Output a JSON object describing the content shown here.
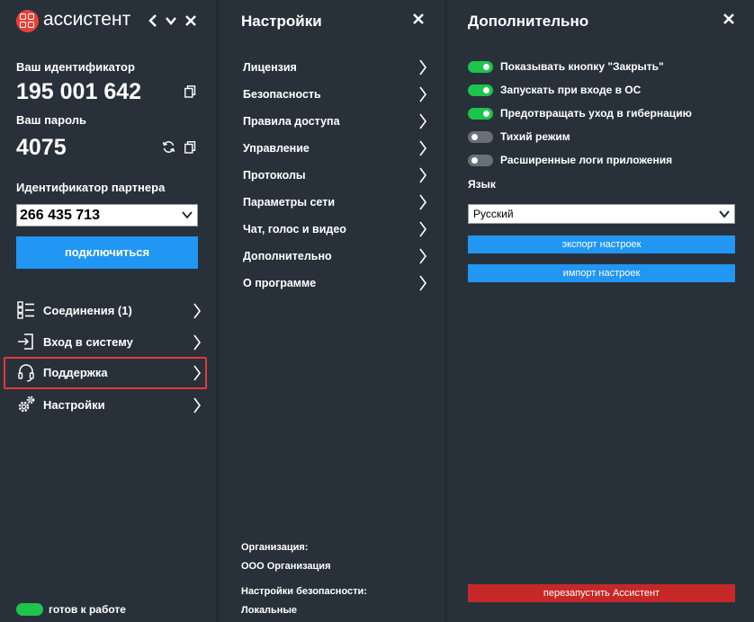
{
  "left_panel": {
    "app_title": "ассистент",
    "id_label": "Ваш идентификатор",
    "id_value": "195 001 642",
    "password_label": "Ваш пароль",
    "password_value": "4075",
    "partner_label": "Идентификатор партнера",
    "partner_value": "266 435 713",
    "connect_label": "подключиться",
    "nav": [
      {
        "label": "Соединения (1)",
        "icon": "list-icon"
      },
      {
        "label": "Вход в систему",
        "icon": "login-icon"
      },
      {
        "label": "Поддержка",
        "icon": "headset-icon"
      },
      {
        "label": "Настройки",
        "icon": "gears-icon"
      }
    ],
    "status_text": "готов к работе"
  },
  "settings_panel": {
    "title": "Настройки",
    "items": [
      "Лицензия",
      "Безопасность",
      "Правила доступа",
      "Управление",
      "Протоколы",
      "Параметры сети",
      "Чат, голос и видео",
      "Дополнительно",
      "О программе"
    ],
    "org_label": "Организация:",
    "org_value": "ООО Организация",
    "security_label": "Настройки безопасности:",
    "security_value": "Локальные"
  },
  "advanced_panel": {
    "title": "Дополнительно",
    "options": [
      {
        "label": "Показывать кнопку \"Закрыть\"",
        "on": true
      },
      {
        "label": "Запускать при входе в ОС",
        "on": true
      },
      {
        "label": "Предотвращать уход в гибернацию",
        "on": true
      },
      {
        "label": "Тихий режим",
        "on": false
      },
      {
        "label": "Расширенные логи приложения",
        "on": false
      }
    ],
    "language_label": "Язык",
    "language_value": "Русский",
    "export_label": "экспорт настроек",
    "import_label": "импорт настроек",
    "restart_label": "перезапустить Ассистент"
  },
  "colors": {
    "accent": "#2196f3",
    "toggle_on": "#1ec44b",
    "danger": "#c62828",
    "highlight": "#e53935"
  }
}
